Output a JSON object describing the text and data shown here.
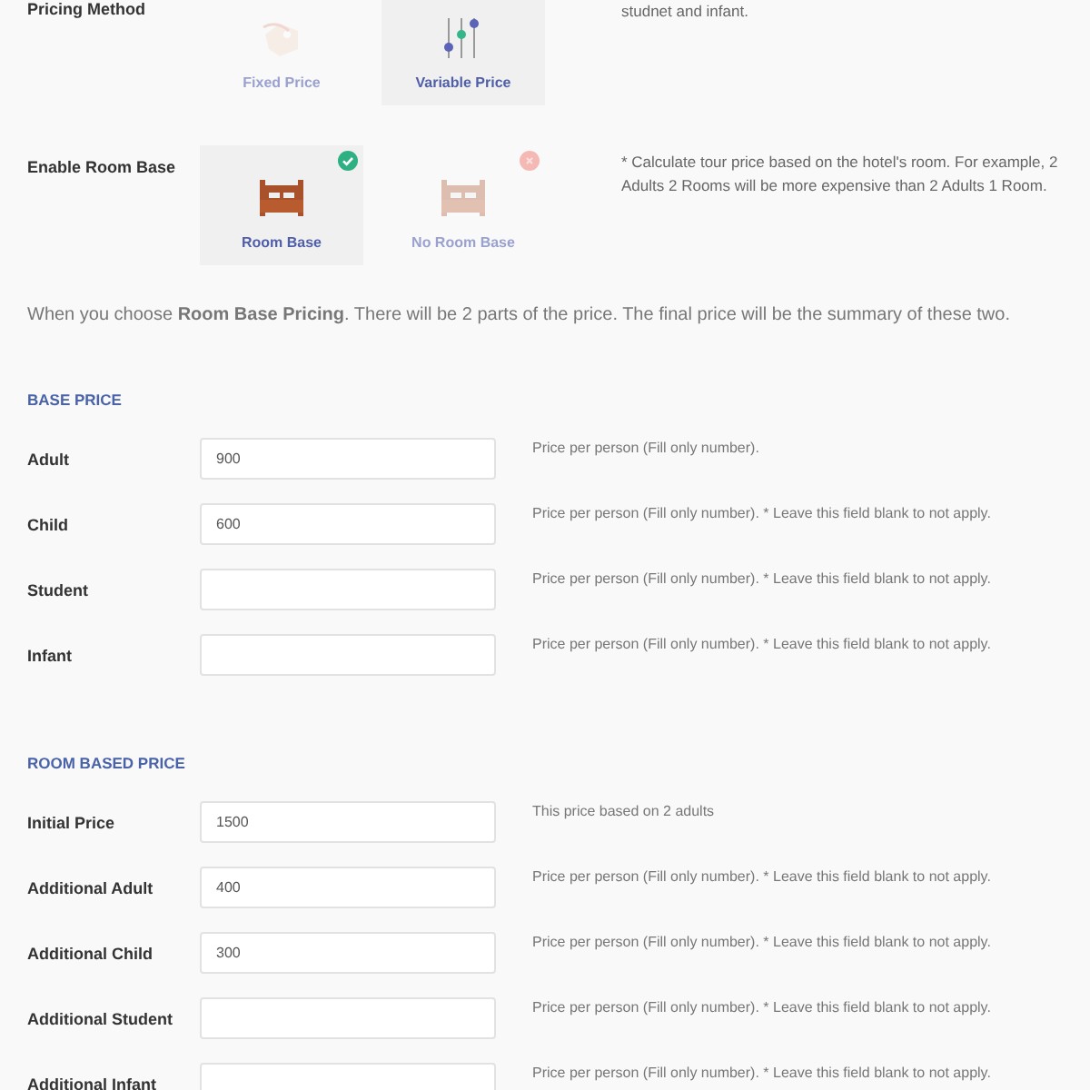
{
  "pricing_method": {
    "label": "Pricing Method",
    "description": "studnet and infant.",
    "options": [
      {
        "kind": "tag",
        "label": "Fixed Price",
        "selected": false
      },
      {
        "kind": "sliders",
        "label": "Variable Price",
        "selected": true
      }
    ]
  },
  "room_base": {
    "label": "Enable Room Base",
    "description": "* Calculate tour price based on the hotel's room. For example, 2 Adults 2 Rooms will be more expensive than 2 Adults 1 Room.",
    "options": [
      {
        "kind": "bed",
        "label": "Room Base",
        "selected": true
      },
      {
        "kind": "bed",
        "label": "No Room Base",
        "selected": false
      }
    ]
  },
  "note": "When you choose **Room Base Pricing**. There will be 2 parts of the price. The final price will be the summary of these two.",
  "sections": [
    {
      "title": "BASE PRICE",
      "fields": [
        {
          "label": "Adult",
          "value": "900",
          "help": "Price per person (Fill only number)."
        },
        {
          "label": "Child",
          "value": "600",
          "help": "Price per person (Fill only number). * Leave this field blank to not apply."
        },
        {
          "label": "Student",
          "help": "Price per person (Fill only number). * Leave this field blank to not apply."
        },
        {
          "label": "Infant",
          "help": "Price per person (Fill only number). * Leave this field blank to not apply."
        }
      ]
    },
    {
      "title": "ROOM BASED PRICE",
      "fields": [
        {
          "label": "Initial Price",
          "value": "1500",
          "help": "This price based on 2 adults"
        },
        {
          "label": "Additional Adult",
          "value": "400",
          "help": "Price per person (Fill only number). * Leave this field blank to not apply."
        },
        {
          "label": "Additional Child",
          "value": "300",
          "help": "Price per person (Fill only number). * Leave this field blank to not apply."
        },
        {
          "label": "Additional Student",
          "help": "Price per person (Fill only number). * Leave this field blank to not apply."
        },
        {
          "label": "Additional Infant",
          "help": "Price per person (Fill only number). * Leave this field blank to not apply."
        }
      ]
    }
  ]
}
